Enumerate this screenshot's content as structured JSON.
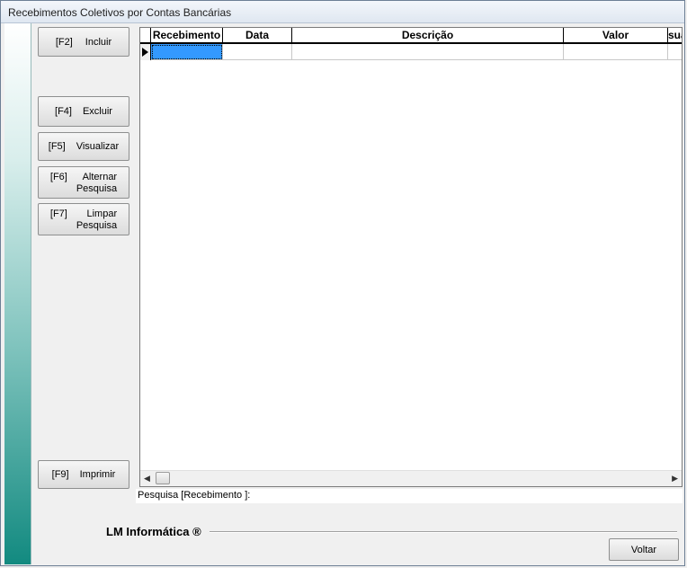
{
  "window": {
    "title": "Recebimentos Coletivos por Contas Bancárias"
  },
  "buttons": {
    "incluir": {
      "key": "[F2]",
      "label": "Incluir"
    },
    "excluir": {
      "key": "[F4]",
      "label": "Excluir"
    },
    "visualizar": {
      "key": "[F5]",
      "label": "Visualizar"
    },
    "alternar": {
      "key": "[F6]",
      "label": "Alternar\nPesquisa"
    },
    "limpar": {
      "key": "[F7]",
      "label": "Limpar\nPesquisa"
    },
    "imprimir": {
      "key": "[F9]",
      "label": "Imprimir"
    },
    "voltar": {
      "label": "Voltar"
    }
  },
  "grid": {
    "columns": [
      "Recebimento",
      "Data",
      "Descrição",
      "Valor",
      "suá"
    ],
    "rows": [
      [
        "",
        "",
        "",
        "",
        ""
      ]
    ],
    "selected_cell": "Recebimento"
  },
  "search": {
    "label": "Pesquisa [Recebimento ]:",
    "value": ""
  },
  "footer": {
    "brand": "LM Informática ®"
  },
  "colors": {
    "selection": "#3399ff",
    "side_strip_bottom": "#128a80"
  }
}
